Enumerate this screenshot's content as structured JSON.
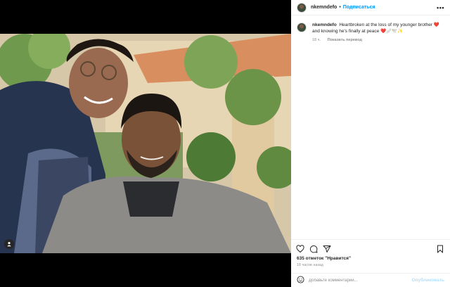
{
  "post": {
    "username": "nkemndefo",
    "follow_label": "Подписаться",
    "more_label": "•••",
    "dot": "•"
  },
  "caption": {
    "username": "nkemndefo",
    "text": "Heartbroken at the loss of my younger brother ❤️ and knowing he's finally at peace ❤️🩹🕊️✨",
    "time": "18 ч.",
    "translate_label": "Показать перевод"
  },
  "actions": {
    "likes_text": "635 отметок \"Нравится\"",
    "time_ago": "18 часов назад"
  },
  "comment_box": {
    "placeholder": "Добавьте комментарий...",
    "publish_label": "Опубликовать"
  },
  "icons": [
    "user-tag-icon",
    "heart-icon",
    "comment-icon",
    "share-icon",
    "bookmark-icon",
    "emoji-icon",
    "more-icon"
  ],
  "colors": {
    "accent": "#0095f6",
    "publish_disabled": "#b2dffc",
    "muted": "#8e8e8e"
  }
}
